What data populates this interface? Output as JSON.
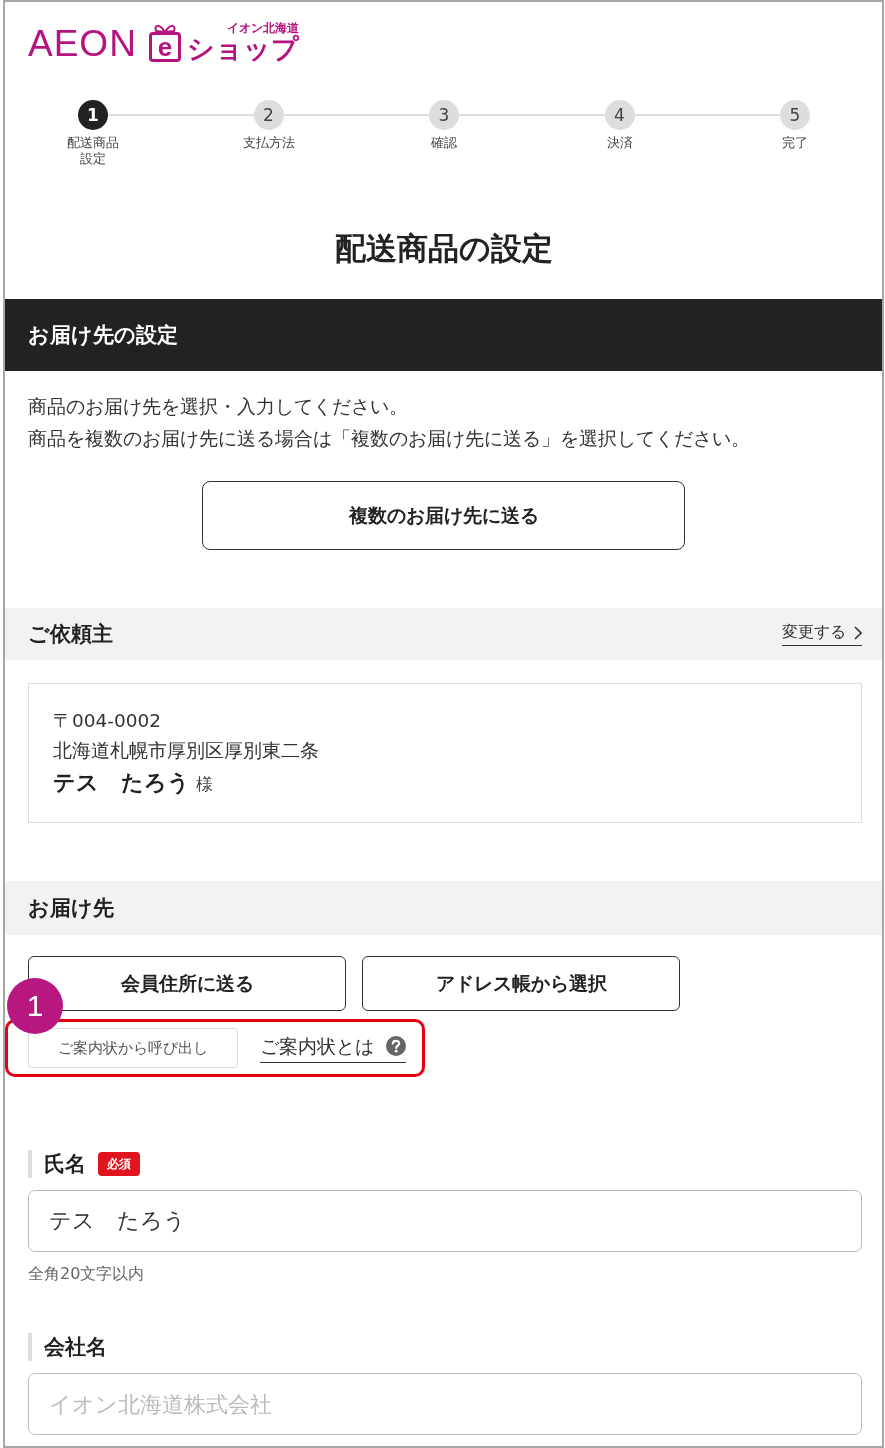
{
  "logo": {
    "brand": "AEON",
    "badge_letter": "e",
    "region": "イオン北海道",
    "shop": "ショップ"
  },
  "steps": [
    {
      "number": "1",
      "label": "配送商品設定",
      "current": true
    },
    {
      "number": "2",
      "label": "支払方法",
      "current": false
    },
    {
      "number": "3",
      "label": "確認",
      "current": false
    },
    {
      "number": "4",
      "label": "決済",
      "current": false
    },
    {
      "number": "5",
      "label": "完了",
      "current": false
    }
  ],
  "page_title": "配送商品の設定",
  "section_bar": {
    "title": "お届け先の設定"
  },
  "intro": [
    "商品のお届け先を選択・入力してください。",
    "商品を複数のお届け先に送る場合は「複数のお届け先に送る」を選択してください。"
  ],
  "multi_button": "複数のお届け先に送る",
  "requester": {
    "title": "ご依頼主",
    "change_link": "変更する",
    "postal": "〒004-0002",
    "address": "北海道札幌市厚別区厚別東二条",
    "name": "テス　たろう",
    "honorific": "様"
  },
  "destination": {
    "title": "お届け先",
    "buttons": [
      "会員住所に送る",
      "アドレス帳から選択"
    ],
    "letter_button": "ご案内状から呼び出し",
    "letter_help_link": "ご案内状とは"
  },
  "annotation": {
    "number": "1"
  },
  "fields": [
    {
      "label": "氏名",
      "required": true,
      "required_badge": "必須",
      "value": "テス　たろう",
      "hint": "全角20文字以内"
    },
    {
      "label": "会社名",
      "required": false,
      "placeholder": "イオン北海道株式会社"
    }
  ]
}
